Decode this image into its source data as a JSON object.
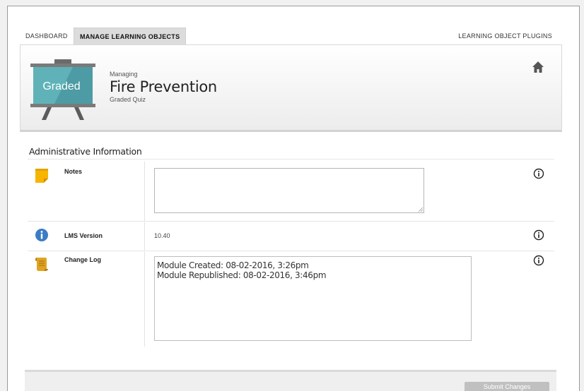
{
  "nav": {
    "dashboard": "DASHBOARD",
    "manage": "MANAGE LEARNING OBJECTS",
    "plugins": "LEARNING OBJECT PLUGINS"
  },
  "header": {
    "badge_text": "Graded",
    "managing_label": "Managing",
    "title": "Fire Prevention",
    "subtitle": "Graded Quiz",
    "home_icon": "home-icon"
  },
  "section": {
    "title": "Administrative Information"
  },
  "rows": {
    "notes": {
      "label": "Notes",
      "icon": "sticky-note-icon",
      "value": ""
    },
    "lms": {
      "label": "LMS Version",
      "icon": "info-circle-icon",
      "value": "10.40"
    },
    "changelog": {
      "label": "Change Log",
      "icon": "scroll-icon",
      "lines": [
        "Module Created: 08-02-2016, 3:26pm",
        "Module Republished: 08-02-2016, 3:46pm"
      ]
    }
  },
  "footer": {
    "submit_label": "Submit Changes"
  },
  "colors": {
    "badge_teal": "#5fb3b8",
    "note_yellow": "#f7b500",
    "info_blue": "#3b7dc4",
    "scroll_gold": "#d99a1f"
  }
}
